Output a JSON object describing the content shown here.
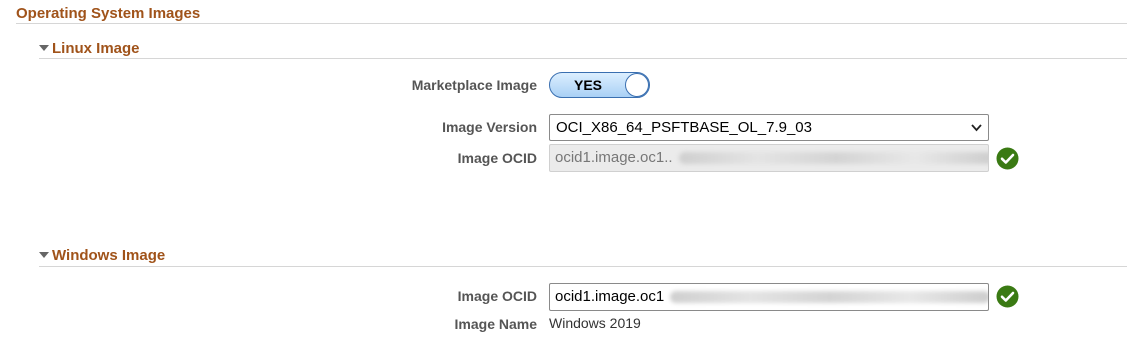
{
  "section": {
    "title": "Operating System Images"
  },
  "linux": {
    "heading": "Linux Image",
    "marketplace_label": "Marketplace Image",
    "marketplace_toggle": "YES",
    "version_label": "Image Version",
    "version_value": "OCI_X86_64_PSFTBASE_OL_7.9_03",
    "ocid_label": "Image OCID",
    "ocid_value": "ocid1.image.oc1..",
    "ocid_status_icon": "check-circle"
  },
  "windows": {
    "heading": "Windows Image",
    "ocid_label": "Image OCID",
    "ocid_value": "ocid1.image.oc1",
    "ocid_status_icon": "check-circle",
    "name_label": "Image Name",
    "name_value": "Windows 2019"
  },
  "colors": {
    "heading": "#a0531a",
    "valid": "#3a7a13",
    "toggle": "#a9d0f5"
  }
}
